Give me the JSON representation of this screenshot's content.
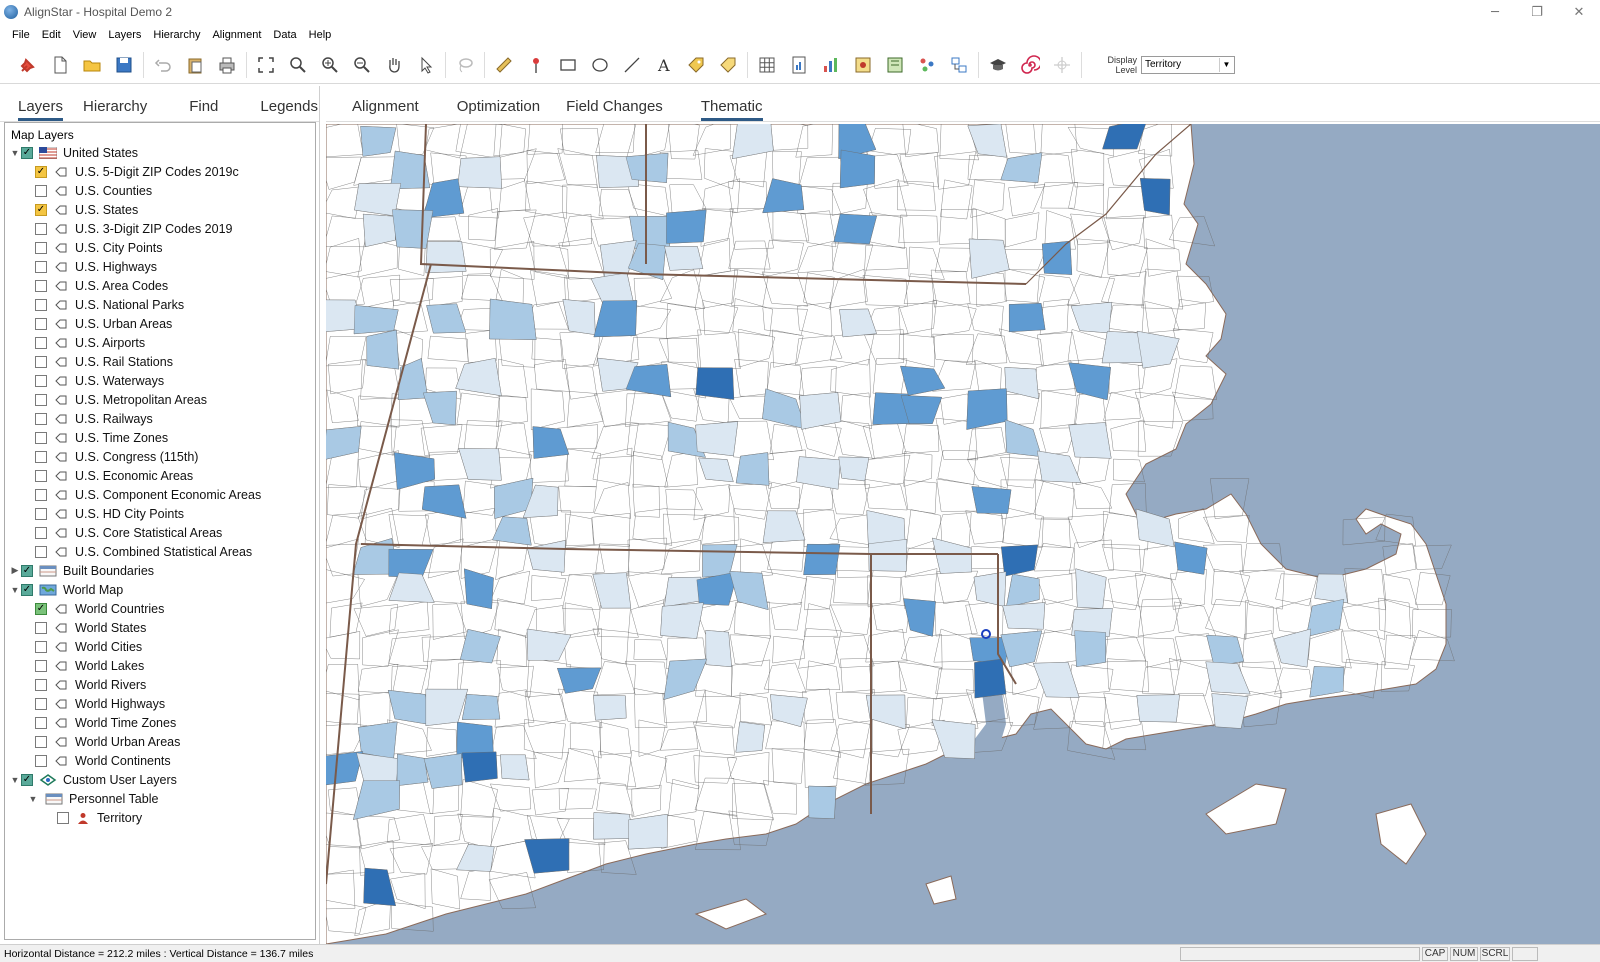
{
  "window": {
    "title": "AlignStar - Hospital Demo 2",
    "controls": {
      "minimize": "─",
      "restore": "❐",
      "close": "✕"
    }
  },
  "menu": [
    "File",
    "Edit",
    "View",
    "Layers",
    "Hierarchy",
    "Alignment",
    "Data",
    "Help"
  ],
  "toolbar": {
    "icons": [
      "pin-icon",
      "new-file-icon",
      "open-folder-icon",
      "save-icon",
      "undo-icon",
      "paste-icon",
      "print-icon",
      "zoom-extent-icon",
      "zoom-icon",
      "zoom-in-icon",
      "zoom-out-icon",
      "pan-hand-icon",
      "select-arrow-icon",
      "lasso-icon",
      "ruler-icon",
      "marker-icon",
      "rectangle-icon",
      "ellipse-icon",
      "line-icon",
      "text-icon",
      "label-tag-icon",
      "tag-icon",
      "grid-table-icon",
      "report-icon",
      "bar-chart-icon",
      "map-gear-icon",
      "map-book-icon",
      "people-icon",
      "hierarchy-icon",
      "graduation-cap-icon",
      "spiral-icon",
      "crosshair-icon"
    ],
    "display_level_label_line1": "Display",
    "display_level_label_line2": "Level",
    "display_level_value": "Territory"
  },
  "left_tabs": [
    {
      "label": "Layers",
      "active": true
    },
    {
      "label": "Hierarchy",
      "active": false
    },
    {
      "label": "Find",
      "active": false
    },
    {
      "label": "Legends",
      "active": false
    }
  ],
  "layers_title": "Map Layers",
  "layers": [
    {
      "label": "United States",
      "level": 0,
      "expand": "down",
      "check": "teal",
      "icon": "us-flag-icon"
    },
    {
      "label": "U.S. 5-Digit ZIP Codes 2019c",
      "level": 1,
      "check": "yellow",
      "icon": "polygon-icon"
    },
    {
      "label": "U.S. Counties",
      "level": 1,
      "check": "none",
      "icon": "polygon-icon"
    },
    {
      "label": "U.S. States",
      "level": 1,
      "check": "yellow",
      "icon": "polygon-icon"
    },
    {
      "label": "U.S. 3-Digit ZIP Codes 2019",
      "level": 1,
      "check": "none",
      "icon": "polygon-icon"
    },
    {
      "label": "U.S. City Points",
      "level": 1,
      "check": "none",
      "icon": "polygon-icon"
    },
    {
      "label": "U.S. Highways",
      "level": 1,
      "check": "none",
      "icon": "polygon-icon"
    },
    {
      "label": "U.S. Area Codes",
      "level": 1,
      "check": "none",
      "icon": "polygon-icon"
    },
    {
      "label": "U.S. National Parks",
      "level": 1,
      "check": "none",
      "icon": "polygon-icon"
    },
    {
      "label": "U.S. Urban Areas",
      "level": 1,
      "check": "none",
      "icon": "polygon-icon"
    },
    {
      "label": "U.S. Airports",
      "level": 1,
      "check": "none",
      "icon": "polygon-icon"
    },
    {
      "label": "U.S. Rail Stations",
      "level": 1,
      "check": "none",
      "icon": "polygon-icon"
    },
    {
      "label": "U.S. Waterways",
      "level": 1,
      "check": "none",
      "icon": "polygon-icon"
    },
    {
      "label": "U.S. Metropolitan Areas",
      "level": 1,
      "check": "none",
      "icon": "polygon-icon"
    },
    {
      "label": "U.S. Railways",
      "level": 1,
      "check": "none",
      "icon": "polygon-icon"
    },
    {
      "label": "U.S. Time Zones",
      "level": 1,
      "check": "none",
      "icon": "polygon-icon"
    },
    {
      "label": "U.S. Congress (115th)",
      "level": 1,
      "check": "none",
      "icon": "polygon-icon"
    },
    {
      "label": "U.S. Economic Areas",
      "level": 1,
      "check": "none",
      "icon": "polygon-icon"
    },
    {
      "label": "U.S. Component Economic Areas",
      "level": 1,
      "check": "none",
      "icon": "polygon-icon"
    },
    {
      "label": "U.S. HD City Points",
      "level": 1,
      "check": "none",
      "icon": "polygon-icon"
    },
    {
      "label": "U.S. Core Statistical Areas",
      "level": 1,
      "check": "none",
      "icon": "polygon-icon"
    },
    {
      "label": "U.S. Combined Statistical Areas",
      "level": 1,
      "check": "none",
      "icon": "polygon-icon"
    },
    {
      "label": "Built Boundaries",
      "level": 0,
      "expand": "right",
      "check": "teal",
      "icon": "table-group-icon"
    },
    {
      "label": "World Map",
      "level": 0,
      "expand": "down",
      "check": "teal",
      "icon": "world-map-icon"
    },
    {
      "label": "World Countries",
      "level": 1,
      "check": "green",
      "icon": "polygon-icon"
    },
    {
      "label": "World States",
      "level": 1,
      "check": "none",
      "icon": "polygon-icon"
    },
    {
      "label": "World Cities",
      "level": 1,
      "check": "none",
      "icon": "polygon-icon"
    },
    {
      "label": "World Lakes",
      "level": 1,
      "check": "none",
      "icon": "polygon-icon"
    },
    {
      "label": "World Rivers",
      "level": 1,
      "check": "none",
      "icon": "polygon-icon"
    },
    {
      "label": "World Highways",
      "level": 1,
      "check": "none",
      "icon": "polygon-icon"
    },
    {
      "label": "World Time Zones",
      "level": 1,
      "check": "none",
      "icon": "polygon-icon"
    },
    {
      "label": "World Urban Areas",
      "level": 1,
      "check": "none",
      "icon": "polygon-icon"
    },
    {
      "label": "World Continents",
      "level": 1,
      "check": "none",
      "icon": "polygon-icon"
    },
    {
      "label": "Custom User Layers",
      "level": 0,
      "expand": "down",
      "check": "teal",
      "icon": "custom-layers-icon"
    },
    {
      "label": "Personnel Table",
      "level": 1,
      "expand": "down",
      "check": "nocheck",
      "icon": "table-group-icon"
    },
    {
      "label": "Territory",
      "level": 2,
      "check": "none",
      "icon": "person-icon"
    }
  ],
  "content_tabs": [
    {
      "label": "Alignment",
      "active": false
    },
    {
      "label": "Optimization",
      "active": false
    },
    {
      "label": "Field Changes",
      "active": false
    },
    {
      "label": "Thematic",
      "active": true
    }
  ],
  "map": {
    "water_color": "#95aac3",
    "land_color": "#ffffff",
    "border_color": "#7a5a4a",
    "shade_colors": [
      "#dbe7f2",
      "#a9c9e4",
      "#5f9bd2",
      "#2f6fb4"
    ]
  },
  "status": {
    "text": "Horizontal Distance = 212.2 miles  :  Vertical Distance = 136.7 miles",
    "panes": [
      "",
      "CAP",
      "NUM",
      "SCRL",
      ""
    ]
  }
}
